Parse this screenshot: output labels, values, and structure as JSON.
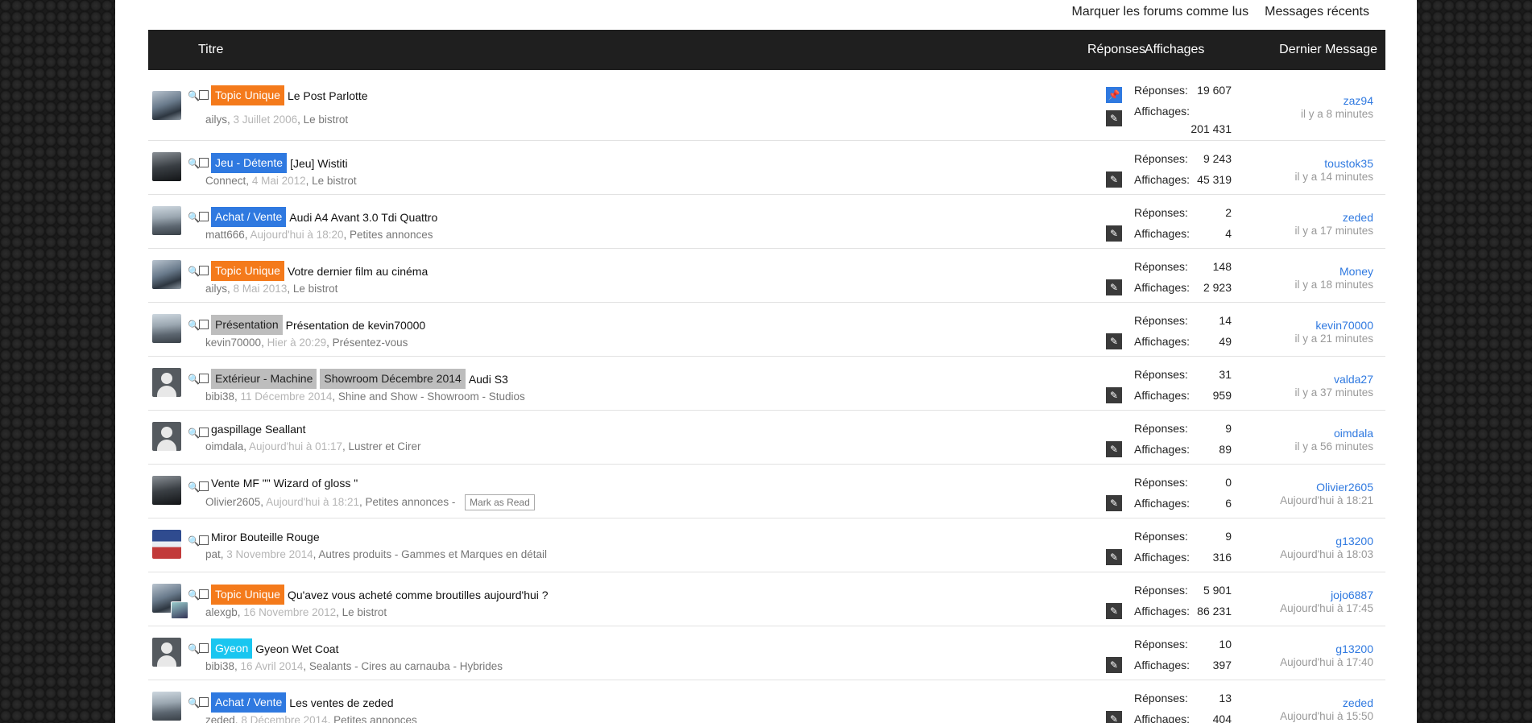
{
  "header_links": {
    "mark_read": "Marquer les forums comme lus",
    "recent": "Messages récents"
  },
  "table_header": {
    "title": "Titre",
    "replies": "Réponses",
    "views": "Affichages",
    "last": "Dernier Message"
  },
  "labels": {
    "replies": "Réponses:",
    "views": "Affichages:"
  },
  "mark_as_read": "Mark as Read",
  "threads": [
    {
      "prefixes": [
        {
          "text": "Topic Unique",
          "color": "orange"
        }
      ],
      "title": "Le Post Parlotte",
      "author": "ailys",
      "date": "3 Juillet 2006",
      "forum": "Le bistrot",
      "replies": "19 607",
      "views": "201 431",
      "last_user": "zaz94",
      "last_time": "il y a 8 minutes",
      "sticky": true
    },
    {
      "prefixes": [
        {
          "text": "Jeu - Détente",
          "color": "blue"
        }
      ],
      "title": "[Jeu] Wistiti",
      "author": "Connect",
      "date": "4 Mai 2012",
      "forum": "Le bistrot",
      "replies": "9 243",
      "views": "45 319",
      "last_user": "toustok35",
      "last_time": "il y a 14 minutes"
    },
    {
      "prefixes": [
        {
          "text": "Achat / Vente",
          "color": "blue"
        }
      ],
      "title": "Audi A4 Avant 3.0 Tdi Quattro",
      "author": "matt666",
      "date": "Aujourd'hui à 18:20",
      "forum": "Petites annonces",
      "replies": "2",
      "views": "4",
      "last_user": "zeded",
      "last_time": "il y a 17 minutes"
    },
    {
      "prefixes": [
        {
          "text": "Topic Unique",
          "color": "orange"
        }
      ],
      "title": "Votre dernier film au cinéma",
      "author": "ailys",
      "date": "8 Mai 2013",
      "forum": "Le bistrot",
      "replies": "148",
      "views": "2 923",
      "last_user": "Money",
      "last_time": "il y a 18 minutes"
    },
    {
      "prefixes": [
        {
          "text": "Présentation",
          "color": "grey"
        }
      ],
      "title": "Présentation de kevin70000",
      "author": "kevin70000",
      "date": "Hier à 20:29",
      "forum": "Présentez-vous",
      "replies": "14",
      "views": "49",
      "last_user": "kevin70000",
      "last_time": "il y a 21 minutes"
    },
    {
      "prefixes": [
        {
          "text": "Extérieur - Machine",
          "color": "grey"
        },
        {
          "text": "Showroom Décembre 2014",
          "color": "grey"
        }
      ],
      "title": "Audi S3",
      "author": "bibi38",
      "date": "11 Décembre 2014",
      "forum": "Shine and Show - Showroom - Studios",
      "replies": "31",
      "views": "959",
      "last_user": "valda27",
      "last_time": "il y a 37 minutes"
    },
    {
      "prefixes": [],
      "title": "gaspillage Seallant",
      "author": "oimdala",
      "date": "Aujourd'hui à 01:17",
      "forum": "Lustrer et Cirer",
      "replies": "9",
      "views": "89",
      "last_user": "oimdala",
      "last_time": "il y a 56 minutes"
    },
    {
      "prefixes": [],
      "title": "Vente MF \"\" Wizard of gloss \"",
      "author": "Olivier2605",
      "date": "Aujourd'hui à 18:21",
      "forum": "Petites annonces",
      "replies": "0",
      "views": "6",
      "last_user": "Olivier2605",
      "last_time": "Aujourd'hui à 18:21",
      "mark_read": true
    },
    {
      "prefixes": [],
      "title": "Miror Bouteille Rouge",
      "author": "pat",
      "date": "3 Novembre 2014",
      "forum": "Autres produits - Gammes et Marques en détail",
      "replies": "9",
      "views": "316",
      "last_user": "g13200",
      "last_time": "Aujourd'hui à 18:03"
    },
    {
      "prefixes": [
        {
          "text": "Topic Unique",
          "color": "orange"
        }
      ],
      "title": "Qu'avez vous acheté comme broutilles aujourd'hui ?",
      "author": "alexgb",
      "date": "16 Novembre 2012",
      "forum": "Le bistrot",
      "replies": "5 901",
      "views": "86 231",
      "last_user": "jojo6887",
      "last_time": "Aujourd'hui à 17:45"
    },
    {
      "prefixes": [
        {
          "text": "Gyeon",
          "color": "cyan"
        }
      ],
      "title": "Gyeon Wet Coat",
      "author": "bibi38",
      "date": "16 Avril 2014",
      "forum": "Sealants - Cires au carnauba - Hybrides",
      "replies": "10",
      "views": "397",
      "last_user": "g13200",
      "last_time": "Aujourd'hui à 17:40"
    },
    {
      "prefixes": [
        {
          "text": "Achat / Vente",
          "color": "blue"
        }
      ],
      "title": "Les ventes de zeded",
      "author": "zeded",
      "date": "8 Décembre 2014",
      "forum": "Petites annonces",
      "replies": "13",
      "views": "404",
      "last_user": "zeded",
      "last_time": "Aujourd'hui à 15:50"
    }
  ]
}
